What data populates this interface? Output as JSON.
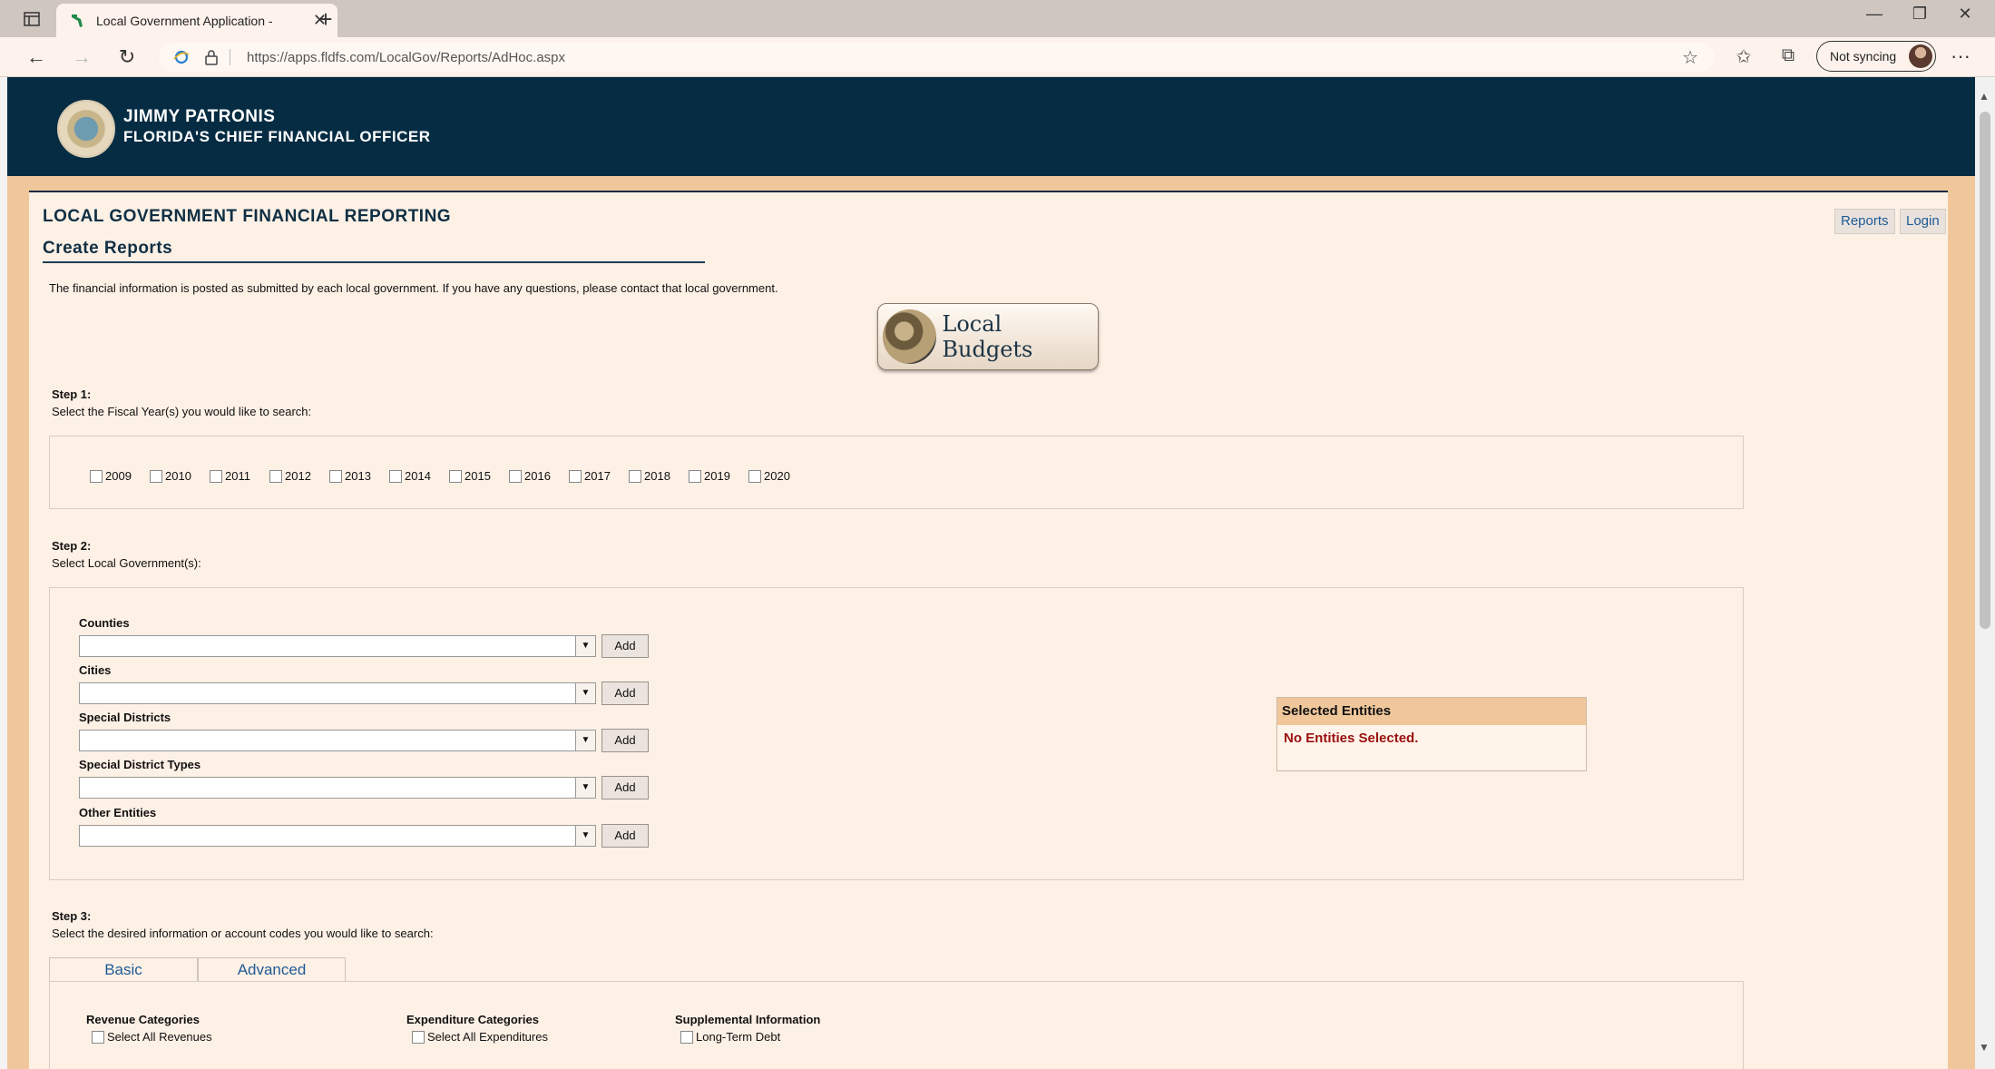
{
  "browser": {
    "tab_title": "Local Government Application - ",
    "url": "https://apps.fldfs.com/LocalGov/Reports/AdHoc.aspx",
    "sync_label": "Not syncing"
  },
  "header": {
    "name": "JIMMY PATRONIS",
    "office": "FLORIDA'S CHIEF FINANCIAL OFFICER"
  },
  "page": {
    "title": "LOCAL GOVERNMENT FINANCIAL REPORTING",
    "subtitle": "Create Reports",
    "nav": {
      "reports": "Reports",
      "login": "Login"
    },
    "intro": "The financial information is posted as submitted by each local government. If you have any questions, please contact that local government.",
    "budget_button": "Local Budgets"
  },
  "step1": {
    "label": "Step 1:",
    "desc": "Select the Fiscal Year(s) you would like to search:",
    "years": [
      "2009",
      "2010",
      "2011",
      "2012",
      "2013",
      "2014",
      "2015",
      "2016",
      "2017",
      "2018",
      "2019",
      "2020"
    ]
  },
  "step2": {
    "label": "Step 2:",
    "desc": "Select Local Government(s):",
    "groups": [
      "Counties",
      "Cities",
      "Special Districts",
      "Special District Types",
      "Other Entities"
    ],
    "add_label": "Add",
    "selected_header": "Selected Entities",
    "selected_empty": "No Entities Selected."
  },
  "step3": {
    "label": "Step 3:",
    "desc": "Select the desired information or account codes you would like to search:",
    "tabs": {
      "basic": "Basic",
      "advanced": "Advanced"
    },
    "revenue_head": "Revenue Categories",
    "revenue_all": "Select All Revenues",
    "expenditure_head": "Expenditure Categories",
    "expenditure_all": "Select All Expenditures",
    "supplemental_head": "Supplemental Information",
    "supplemental_first": "Long-Term Debt"
  },
  "colors": {
    "header_navy": "#062c43",
    "page_bg": "#fdf0e5",
    "accent_tan": "#f0c79b",
    "link_blue": "#1f5a96",
    "error_red": "#9b0f0f"
  }
}
